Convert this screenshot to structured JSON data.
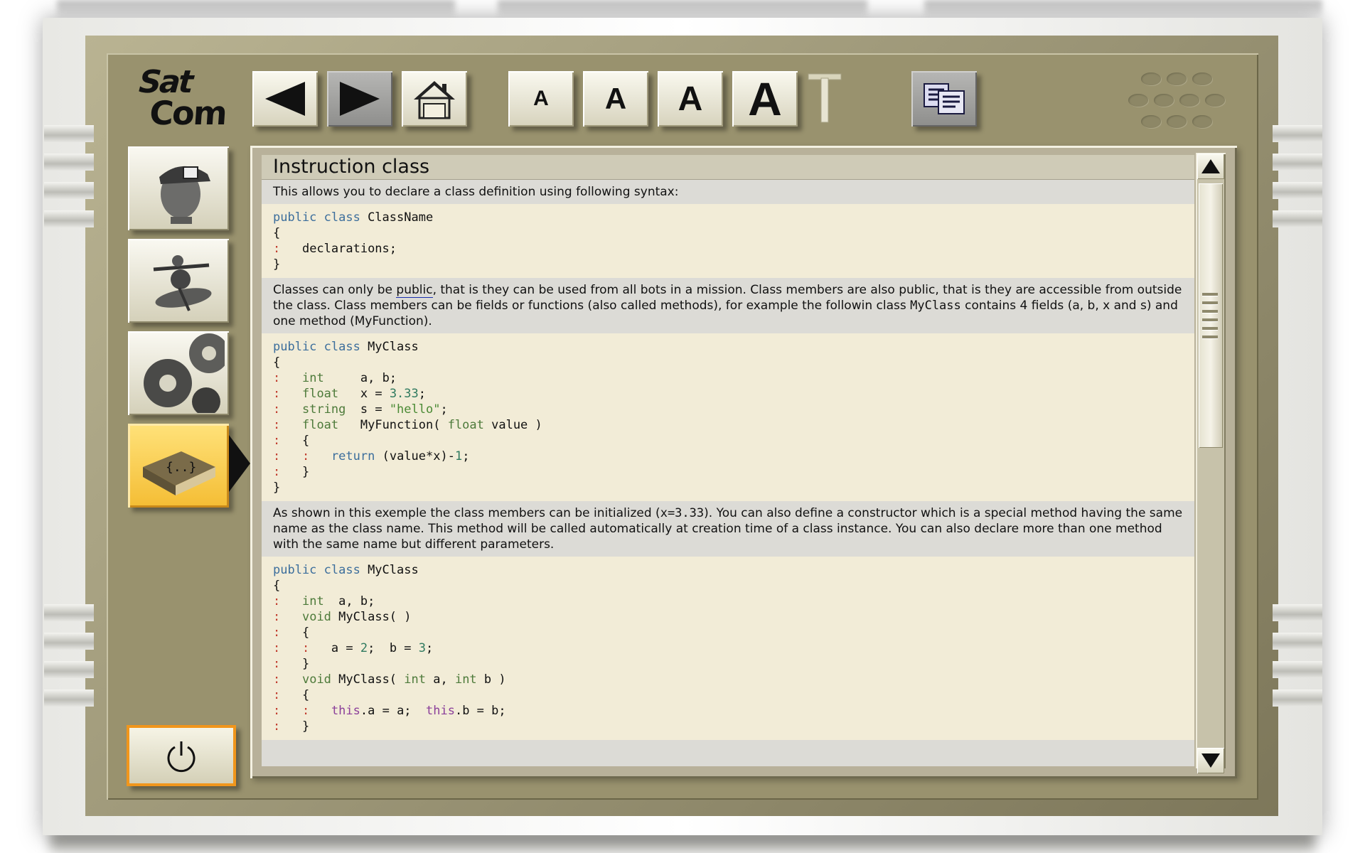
{
  "app": {
    "logo_line1": "Sat",
    "logo_line2": "Com"
  },
  "toolbar": {
    "back_icon": "left-arrow-icon",
    "forward_icon": "right-arrow-icon",
    "home_icon": "home-icon",
    "font_size_1": "A",
    "font_size_2": "A",
    "font_size_3": "A",
    "font_size_4": "A",
    "copy_icon": "copy-documents-icon"
  },
  "nav": {
    "items": [
      {
        "name": "agent-icon"
      },
      {
        "name": "satellite-bot-icon"
      },
      {
        "name": "gears-icon"
      },
      {
        "name": "code-book-icon",
        "active": true
      }
    ],
    "power_icon": "power-icon"
  },
  "doc": {
    "title": "Instruction class",
    "intro": "This allows you to declare a class definition using following syntax:",
    "p2_a": "Classes can only be ",
    "p2_link": "public",
    "p2_b": ", that is they can be used from all bots in a mission. Class members are also public, that is they are accessible from outside the class. Class members can be fields or functions (also called methods), for example the followin class ",
    "p2_code": "MyClass",
    "p2_c": " contains 4 fields (a, b, x and s) and one method (MyFunction).",
    "p3_a": "As shown in this exemple the class members can be initialized (",
    "p3_code": "x=3.33",
    "p3_b": "). You can also define a constructor which is a special method having the same name as the class name. This method will be called automatically at creation time of a class instance. You can also declare more than one method with the same name but different parameters."
  },
  "colors": {
    "panel": "#99926e",
    "active": "#f4bd34",
    "code_bg": "#f2ecd7",
    "keyword": "#3c6e9c",
    "type": "#4d7a3a"
  }
}
